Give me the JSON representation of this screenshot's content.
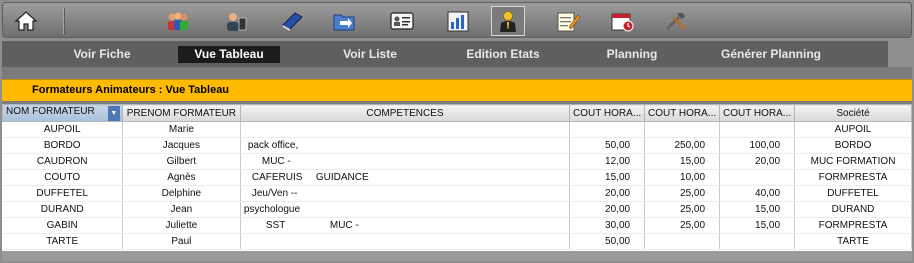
{
  "toolbar": {
    "icons": [
      {
        "name": "home-icon"
      },
      {
        "name": "users-group-icon"
      },
      {
        "name": "contact-phone-icon"
      },
      {
        "name": "book-icon"
      },
      {
        "name": "folder-arrow-icon"
      },
      {
        "name": "id-card-icon"
      },
      {
        "name": "bar-chart-icon"
      },
      {
        "name": "person-icon"
      },
      {
        "name": "edit-note-icon"
      },
      {
        "name": "calendar-icon"
      },
      {
        "name": "tools-icon"
      }
    ]
  },
  "nav": {
    "items": [
      {
        "label": "Voir Fiche"
      },
      {
        "label": "Vue Tableau"
      },
      {
        "label": "Voir Liste"
      },
      {
        "label": "Edition Etats"
      },
      {
        "label": "Planning"
      },
      {
        "label": "Générer Planning"
      }
    ],
    "active": "Vue Tableau"
  },
  "section_title": "Formateurs  Animateurs : Vue Tableau",
  "table": {
    "headers": [
      "NOM FORMATEUR",
      "PRENOM FORMATEUR",
      "COMPETENCES",
      "COUT HORA...",
      "COUT HORA...",
      "COUT HORA...",
      "Société"
    ],
    "rows": [
      {
        "nom": "AUPOIL",
        "prenom": "Marie",
        "comp1": "",
        "comp2": "",
        "c1": "",
        "c2": "",
        "c3": "",
        "societe": "AUPOIL"
      },
      {
        "nom": "BORDO",
        "prenom": "Jacques",
        "comp1": "pack office,",
        "comp2": "",
        "c1": "50,00",
        "c2": "250,00",
        "c3": "100,00",
        "societe": "BORDO"
      },
      {
        "nom": "CAUDRON",
        "prenom": "Gilbert",
        "comp1": "MUC -",
        "comp2": "",
        "c1": "12,00",
        "c2": "15,00",
        "c3": "20,00",
        "societe": "MUC FORMATION"
      },
      {
        "nom": "COUTO",
        "prenom": "Agnès",
        "comp1": "CAFERUIS",
        "comp2": "GUIDANCE",
        "c1": "15,00",
        "c2": "10,00",
        "c3": "",
        "societe": "FORMPRESTA"
      },
      {
        "nom": "DUFFETEL",
        "prenom": "Delphine",
        "comp1": "Jeu/Ven --",
        "comp2": "",
        "c1": "20,00",
        "c2": "25,00",
        "c3": "40,00",
        "societe": "DUFFETEL"
      },
      {
        "nom": "DURAND",
        "prenom": "Jean",
        "comp1": "psychologue",
        "comp2": "",
        "c1": "20,00",
        "c2": "25,00",
        "c3": "15,00",
        "societe": "DURAND"
      },
      {
        "nom": "GABIN",
        "prenom": "Juliette",
        "comp1": "SST",
        "comp2": "MUC -",
        "c1": "30,00",
        "c2": "25,00",
        "c3": "15,00",
        "societe": "FORMPRESTA"
      },
      {
        "nom": "TARTE",
        "prenom": "Paul",
        "comp1": "",
        "comp2": "",
        "c1": "50,00",
        "c2": "",
        "c3": "",
        "societe": "TARTE"
      }
    ]
  },
  "colors": {
    "accent": "#ffbb00",
    "toolbar": "#7f7f7f",
    "nav_bg": "#5f5f5f",
    "active_tab": "#1c1c1c"
  }
}
